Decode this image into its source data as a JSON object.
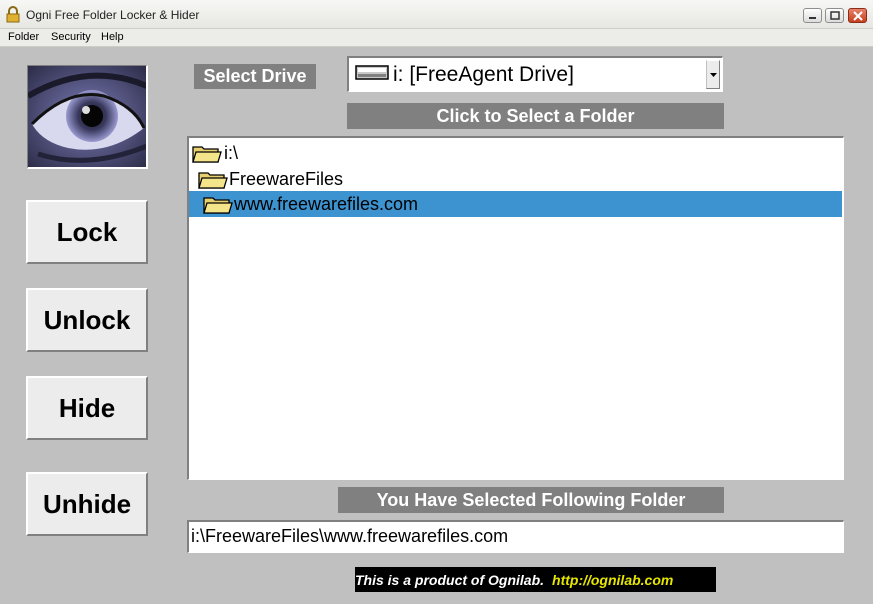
{
  "window": {
    "title": "Ogni Free Folder Locker & Hider"
  },
  "menu": {
    "items": [
      "Folder",
      "Security",
      "Help"
    ]
  },
  "actions": {
    "lock": "Lock",
    "unlock": "Unlock",
    "hide": "Hide",
    "unhide": "Unhide"
  },
  "drive": {
    "label": "Select Drive",
    "selected": "i: [FreeAgent Drive]",
    "icon": "drive-icon"
  },
  "folders": {
    "header": "Click to Select a Folder",
    "tree": [
      {
        "label": "i:\\",
        "depth": 0,
        "selected": false
      },
      {
        "label": "FreewareFiles",
        "depth": 1,
        "selected": false
      },
      {
        "label": "www.freewarefiles.com",
        "depth": 2,
        "selected": true
      }
    ]
  },
  "selection": {
    "header": "You Have Selected Following Folder",
    "path": "i:\\FreewareFiles\\www.freewarefiles.com"
  },
  "footer": {
    "text": "This  is a product of Ognilab.",
    "link": "http://ognilab.com"
  },
  "colors": {
    "selection": "#3d92d0",
    "label_bg": "#808080",
    "footer_link": "#e6e600"
  }
}
